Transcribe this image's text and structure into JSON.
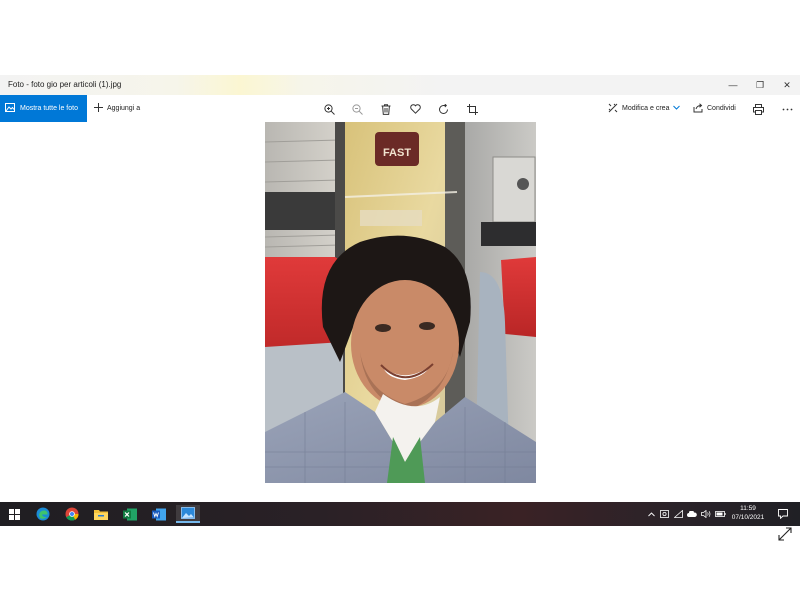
{
  "window": {
    "title": "Foto - foto gio per articoli (1).jpg",
    "controls": {
      "minimize": "—",
      "restore": "❐",
      "close": "✕"
    }
  },
  "toolbar": {
    "show_all_label": "Mostra tutte le foto",
    "add_to_label": "Aggiungi a",
    "edit_create_label": "Modifica e crea",
    "share_label": "Condividi",
    "tools": [
      "zoom-in-icon",
      "zoom-out-icon",
      "trash-icon",
      "heart-icon",
      "rotate-icon",
      "crop-icon"
    ],
    "accent_color": "#0078d7"
  },
  "taskbar": {
    "apps": [
      "windows-start",
      "edge",
      "chrome",
      "file-explorer",
      "excel",
      "word",
      "photos"
    ],
    "active_app": "photos",
    "clock": {
      "time": "11:59",
      "date": "07/10/2021"
    }
  }
}
